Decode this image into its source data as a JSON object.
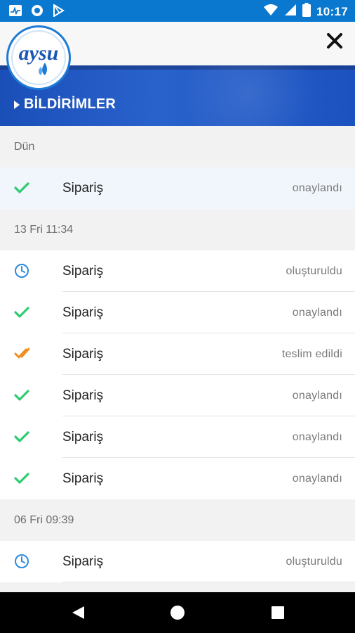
{
  "status_bar": {
    "time": "10:17",
    "icons": [
      "activity-icon",
      "record-icon",
      "play-store-icon",
      "wifi-icon",
      "signal-icon",
      "battery-icon"
    ]
  },
  "header": {
    "logo_text": "aysu",
    "close_icon": "close-icon"
  },
  "banner": {
    "title": "BİLDİRİMLER",
    "arrow_icon": "caret-right-icon"
  },
  "colors": {
    "status_bar": "#0b78d0",
    "banner": "#2a62cc",
    "check_green": "#2ecc71",
    "clock_blue": "#2a8be0",
    "delivered_orange": "#f0901e"
  },
  "groups": [
    {
      "date": "Dün",
      "items": [
        {
          "title": "Sipariş",
          "status": "onaylandı",
          "icon": "check-icon"
        }
      ]
    },
    {
      "date": "13 Fri 11:34",
      "items": [
        {
          "title": "Sipariş",
          "status": "oluşturuldu",
          "icon": "clock-icon"
        },
        {
          "title": "Sipariş",
          "status": "onaylandı",
          "icon": "check-icon"
        },
        {
          "title": "Sipariş",
          "status": "teslim edildi",
          "icon": "double-check-icon"
        },
        {
          "title": "Sipariş",
          "status": "onaylandı",
          "icon": "check-icon"
        },
        {
          "title": "Sipariş",
          "status": "onaylandı",
          "icon": "check-icon"
        },
        {
          "title": "Sipariş",
          "status": "onaylandı",
          "icon": "check-icon"
        }
      ]
    },
    {
      "date": "06 Fri 09:39",
      "items": [
        {
          "title": "Sipariş",
          "status": "oluşturuldu",
          "icon": "clock-icon"
        }
      ]
    }
  ],
  "nav": {
    "back": "back-icon",
    "home": "home-icon",
    "recents": "recents-icon"
  }
}
